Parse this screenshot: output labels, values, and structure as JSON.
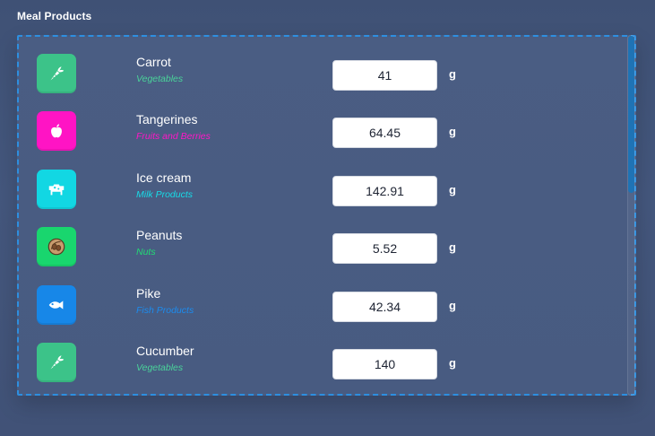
{
  "page": {
    "title": "Meal Products"
  },
  "products": [
    {
      "name": "Carrot",
      "category": "Vegetables",
      "quantity": "41",
      "unit": "g",
      "icon": "carrot-icon",
      "tile_color": "#3cc389",
      "category_color": "#4ad39a"
    },
    {
      "name": "Tangerines",
      "category": "Fruits and Berries",
      "quantity": "64.45",
      "unit": "g",
      "icon": "apple-icon",
      "tile_color": "#ff14c4",
      "category_color": "#ff16c6"
    },
    {
      "name": "Ice cream",
      "category": "Milk Products",
      "quantity": "142.91",
      "unit": "g",
      "icon": "cow-icon",
      "tile_color": "#12d7e3",
      "category_color": "#17dce8"
    },
    {
      "name": "Peanuts",
      "category": "Nuts",
      "quantity": "5.52",
      "unit": "g",
      "icon": "walnut-icon",
      "tile_color": "#19d66e",
      "category_color": "#22db75"
    },
    {
      "name": "Pike",
      "category": "Fish Products",
      "quantity": "42.34",
      "unit": "g",
      "icon": "fish-icon",
      "tile_color": "#1787e8",
      "category_color": "#1c8cee"
    },
    {
      "name": "Cucumber",
      "category": "Vegetables",
      "quantity": "140",
      "unit": "g",
      "icon": "carrot-icon",
      "tile_color": "#3cc389",
      "category_color": "#4ad39a"
    }
  ],
  "scrollbar": {
    "thumb_color": "#1f73b5"
  }
}
